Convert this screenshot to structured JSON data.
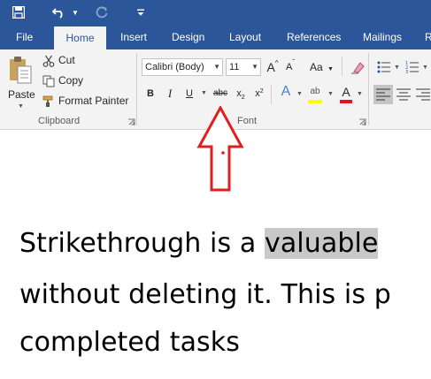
{
  "quick_access": {
    "save_icon": "save-icon",
    "undo_icon": "undo-icon",
    "redo_icon": "redo-icon",
    "customize_icon": "customize-qat-icon"
  },
  "tabs": [
    {
      "label": "File"
    },
    {
      "label": "Home"
    },
    {
      "label": "Insert"
    },
    {
      "label": "Design"
    },
    {
      "label": "Layout"
    },
    {
      "label": "References"
    },
    {
      "label": "Mailings"
    },
    {
      "label": "R"
    }
  ],
  "clipboard": {
    "paste_label": "Paste",
    "cut_label": "Cut",
    "copy_label": "Copy",
    "format_painter_label": "Format Painter",
    "group_label": "Clipboard"
  },
  "font": {
    "font_name": "Calibri (Body)",
    "font_size": "11",
    "grow_label": "A",
    "shrink_label": "A",
    "change_case_label": "Aa",
    "bold_label": "B",
    "italic_label": "I",
    "underline_label": "U",
    "strikethrough_label": "abc",
    "subscript_label": "x",
    "subscript_mark": "2",
    "superscript_label": "x",
    "superscript_mark": "2",
    "effects_label": "A",
    "highlight_label": "ab",
    "font_color_label": "A",
    "group_label": "Font"
  },
  "colors": {
    "brand": "#2b579a",
    "ribbon": "#f3f3f3",
    "arrow": "#e01e1e",
    "highlight_bar": "#ffff00",
    "font_color_bar": "#e81123",
    "text_highlight_bg": "#c8c8c8"
  },
  "document": {
    "line1_before": "Strikethrough is a ",
    "line1_highlight": "valuable",
    "line2": "without deleting it. This is p",
    "line3": "completed tasks"
  }
}
